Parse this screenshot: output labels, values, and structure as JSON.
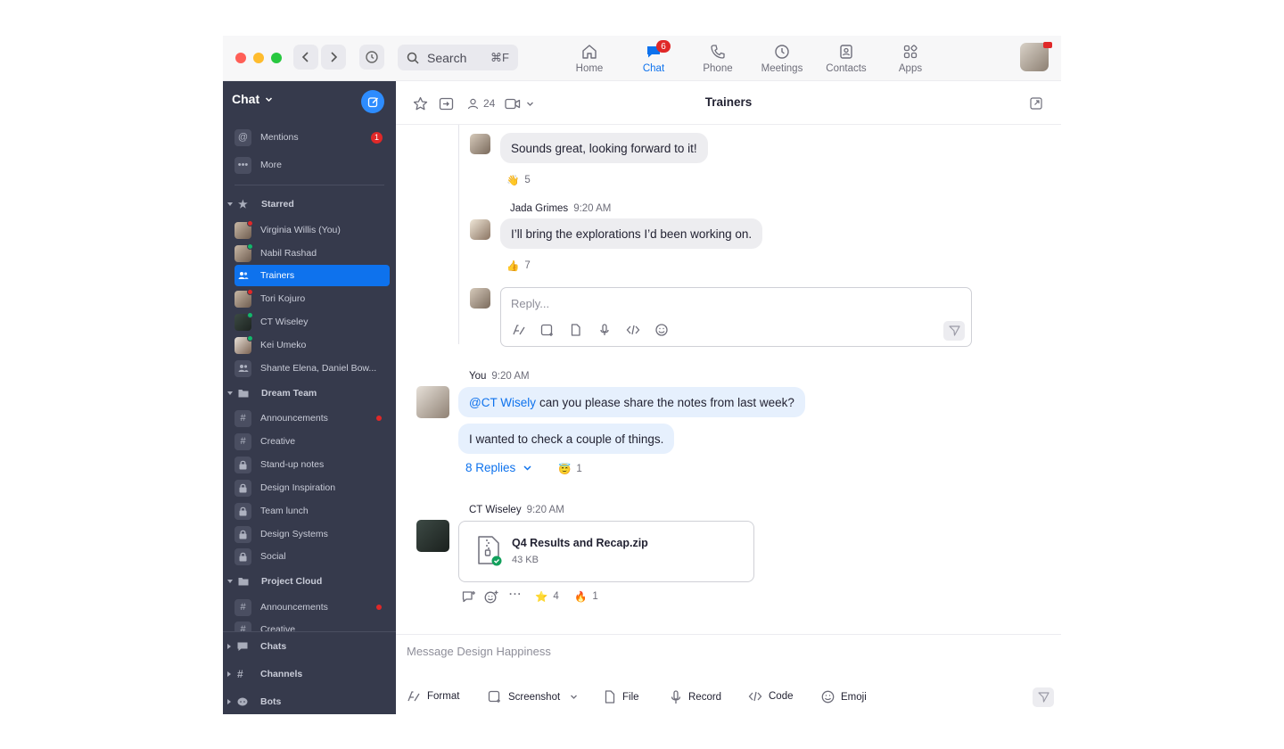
{
  "topbar": {
    "search_placeholder": "Search",
    "search_shortcut": "⌘F",
    "nav": [
      {
        "label": "Home",
        "icon": "home-icon"
      },
      {
        "label": "Chat",
        "icon": "chat-icon",
        "badge": "6"
      },
      {
        "label": "Phone",
        "icon": "phone-icon"
      },
      {
        "label": "Meetings",
        "icon": "clock-icon"
      },
      {
        "label": "Contacts",
        "icon": "contacts-icon"
      },
      {
        "label": "Apps",
        "icon": "apps-icon"
      }
    ],
    "active_nav": "Chat"
  },
  "sidebar": {
    "title": "Chat",
    "top_items": [
      {
        "label": "Mentions",
        "icon": "at-icon",
        "badge": "1"
      },
      {
        "label": "More",
        "icon": "more-icon"
      }
    ],
    "starred_label": "Starred",
    "starred": [
      {
        "label": "Virginia Willis (You)",
        "status": "#e02828"
      },
      {
        "label": "Nabil Rashad",
        "status": "#12b76a"
      },
      {
        "label": "Trainers",
        "active": true
      },
      {
        "label": "Tori Kojuro",
        "status": "#e02828"
      },
      {
        "label": "CT Wiseley",
        "status": "#12b76a"
      },
      {
        "label": "Kei Umeko",
        "status": "#12b76a"
      },
      {
        "label": "Shante Elena, Daniel Bow..."
      }
    ],
    "dream_team_label": "Dream Team",
    "dream_team": [
      {
        "label": "Announcements",
        "icon": "hash-icon",
        "unread": true
      },
      {
        "label": "Creative",
        "icon": "hash-icon"
      },
      {
        "label": "Stand-up notes",
        "icon": "lock-icon"
      },
      {
        "label": "Design Inspiration",
        "icon": "lock-icon"
      },
      {
        "label": "Team lunch",
        "icon": "lock-icon"
      },
      {
        "label": "Design Systems",
        "icon": "lock-icon"
      },
      {
        "label": "Social",
        "icon": "lock-icon"
      }
    ],
    "project_cloud_label": "Project Cloud",
    "project_cloud": [
      {
        "label": "Announcements",
        "icon": "hash-icon",
        "unread": true
      },
      {
        "label": "Creative",
        "icon": "hash-icon"
      }
    ],
    "bottom": [
      {
        "label": "Chats"
      },
      {
        "label": "Channels"
      },
      {
        "label": "Bots"
      }
    ]
  },
  "header": {
    "member_count": "24",
    "title": "Trainers"
  },
  "messages": {
    "thread_msg1": {
      "text": "Sounds great, looking forward to it!",
      "reaction_emoji": "👋",
      "reaction_count": "5"
    },
    "thread_msg2": {
      "sender": "Jada Grimes",
      "time": "9:20 AM",
      "text": "I’ll bring the explorations I’d been working on.",
      "reaction_emoji": "👍",
      "reaction_count": "7"
    },
    "reply_placeholder": "Reply...",
    "you_msg": {
      "sender": "You",
      "time": "9:20 AM",
      "mention": "@CT Wisely",
      "text1": "can you please share the notes from last week?",
      "text2": "I wanted to check a couple of things.",
      "replies": "8 Replies",
      "reaction_emoji": "😇",
      "reaction_count": "1"
    },
    "ct_msg": {
      "sender": "CT Wiseley",
      "time": "9:20 AM",
      "file_name": "Q4  Results and Recap.zip",
      "file_size": "43 KB",
      "reaction1_emoji": "⭐",
      "reaction1_count": "4",
      "reaction2_emoji": "🔥",
      "reaction2_count": "1"
    }
  },
  "composer": {
    "placeholder": "Message Design Happiness",
    "tools": {
      "format": "Format",
      "screenshot": "Screenshot",
      "file": "File",
      "record": "Record",
      "code": "Code",
      "emoji": "Emoji"
    }
  },
  "colors": {
    "accent": "#0e72ed",
    "sidebar_bg": "#363a4c",
    "badge_red": "#e02828",
    "online_green": "#12b76a"
  }
}
